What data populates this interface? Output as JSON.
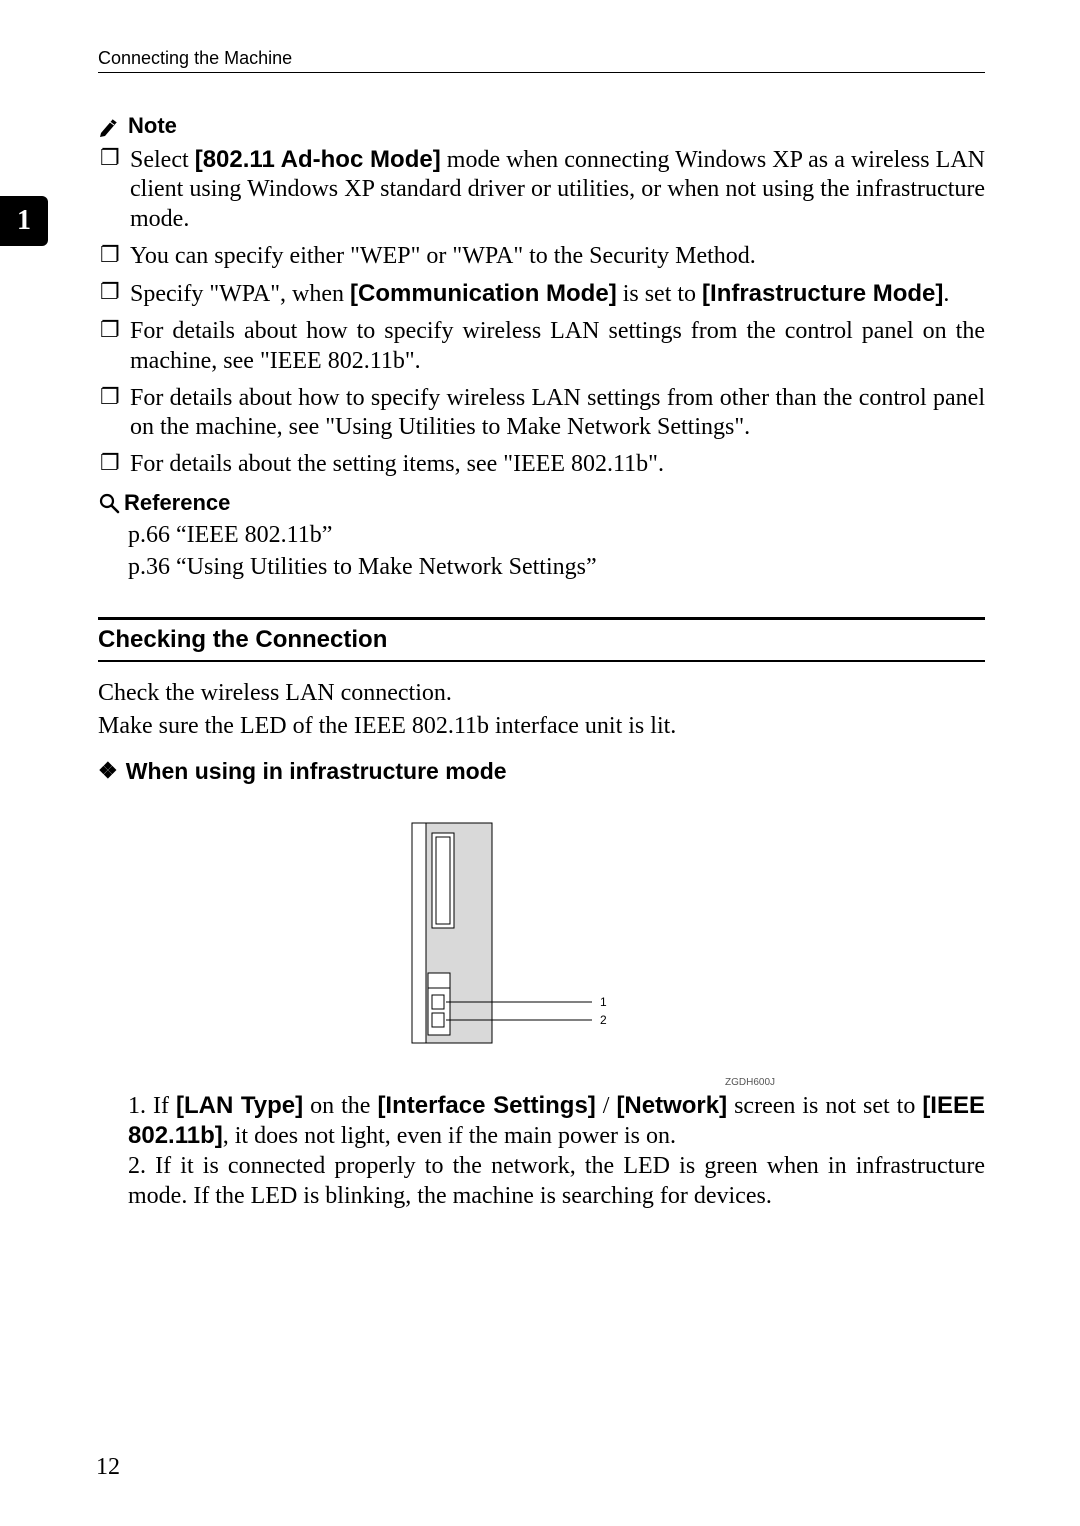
{
  "header": {
    "running_title": "Connecting the Machine"
  },
  "chapter_tab": "1",
  "note": {
    "label": "Note",
    "items": [
      {
        "pre": "Select ",
        "bold1": "[802.11 Ad-hoc Mode]",
        "post": " mode when connecting Windows XP as a wireless LAN client using Windows XP standard driver or utilities, or when not using the infrastructure mode."
      },
      {
        "plain": "You can specify either \"WEP\" or \"WPA\" to the Security Method."
      },
      {
        "pre": "Specify \"WPA\", when ",
        "bold1": "[Communication Mode]",
        "mid": " is set to ",
        "bold2": "[Infrastructure Mode]",
        "post": "."
      },
      {
        "plain": "For details about how to specify wireless LAN settings from the control panel on the machine, see \"IEEE 802.11b\"."
      },
      {
        "plain": "For details about how to specify wireless LAN settings from other than the control panel on the machine, see \"Using Utilities to Make Network Settings\"."
      },
      {
        "plain": "For details about the setting items, see \"IEEE 802.11b\"."
      }
    ]
  },
  "reference": {
    "label": "Reference",
    "lines": [
      "p.66 “IEEE 802.11b”",
      "p.36 “Using Utilities to Make Network Settings”"
    ]
  },
  "section": {
    "title": "Checking the Connection",
    "intro1": "Check the wireless LAN connection.",
    "intro2": "Make sure the LED of the IEEE 802.11b interface unit is lit."
  },
  "subsection": {
    "title": "When using in infrastructure mode"
  },
  "figure": {
    "callouts": [
      "1",
      "2"
    ],
    "id": "ZGDH600J"
  },
  "numbered_text": {
    "line1_pre": "1. If ",
    "line1_b1": "[LAN Type]",
    "line1_mid1": " on the ",
    "line1_b2": "[Interface Settings]",
    "line1_mid2": " / ",
    "line1_b3": "[Network]",
    "line1_mid3": " screen is not set to ",
    "line1_b4": "[IEEE 802.11b]",
    "line1_post": ", it does not light, even if the main power is on.",
    "line2": "2. If it is connected properly to the network, the LED is green when in infrastructure mode. If the LED is blinking, the machine is searching for devices."
  },
  "page_number": "12"
}
